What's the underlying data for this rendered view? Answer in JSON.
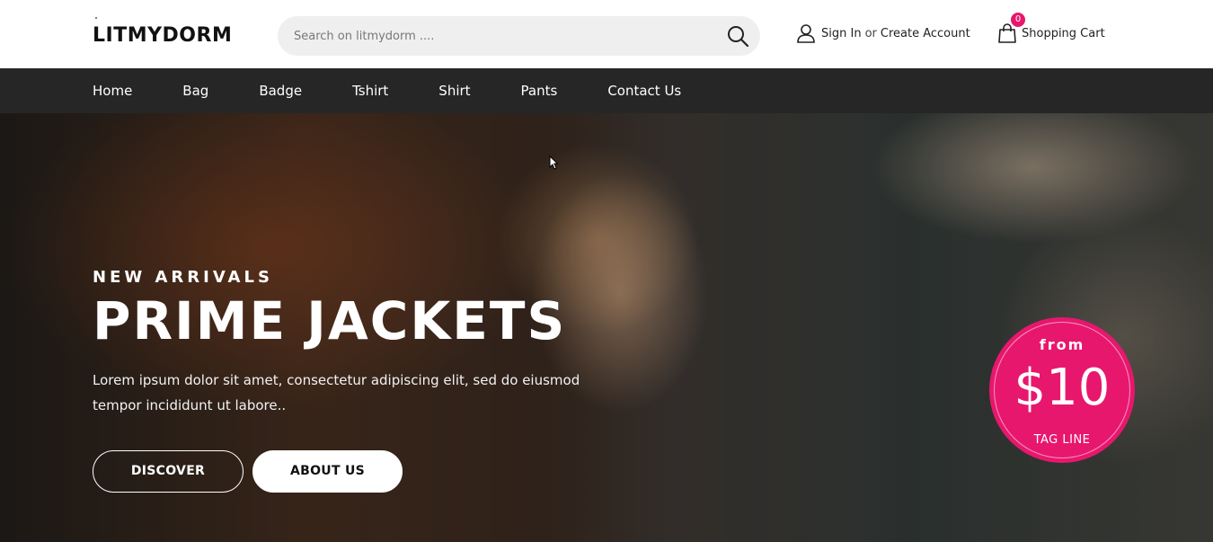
{
  "header": {
    "logo": "LITMYDORM",
    "search": {
      "placeholder": "Search on litmydorm ...."
    },
    "account": {
      "sign_in": "Sign In",
      "or": "or",
      "create_account": "Create Account"
    },
    "cart": {
      "label": "Shopping Cart",
      "count": "0"
    }
  },
  "nav": {
    "items": [
      "Home",
      "Bag",
      "Badge",
      "Tshirt",
      "Shirt",
      "Pants",
      "Contact Us"
    ]
  },
  "hero": {
    "eyebrow": "NEW ARRIVALS",
    "title": "PRIME JACKETS",
    "text": "Lorem ipsum dolor sit amet, consectetur adipiscing elit, sed do eiusmod tempor incididunt ut labore..",
    "buttons": {
      "discover": "DISCOVER",
      "about": "ABOUT US"
    },
    "badge": {
      "from": "from",
      "price": "$10",
      "tagline": "TAG LINE"
    }
  },
  "colors": {
    "accent": "#e8176e",
    "nav_bg": "#262626",
    "search_bg": "#efefef"
  },
  "icons": [
    "search-icon",
    "user-icon",
    "shopping-bag-icon",
    "cursor-icon"
  ]
}
